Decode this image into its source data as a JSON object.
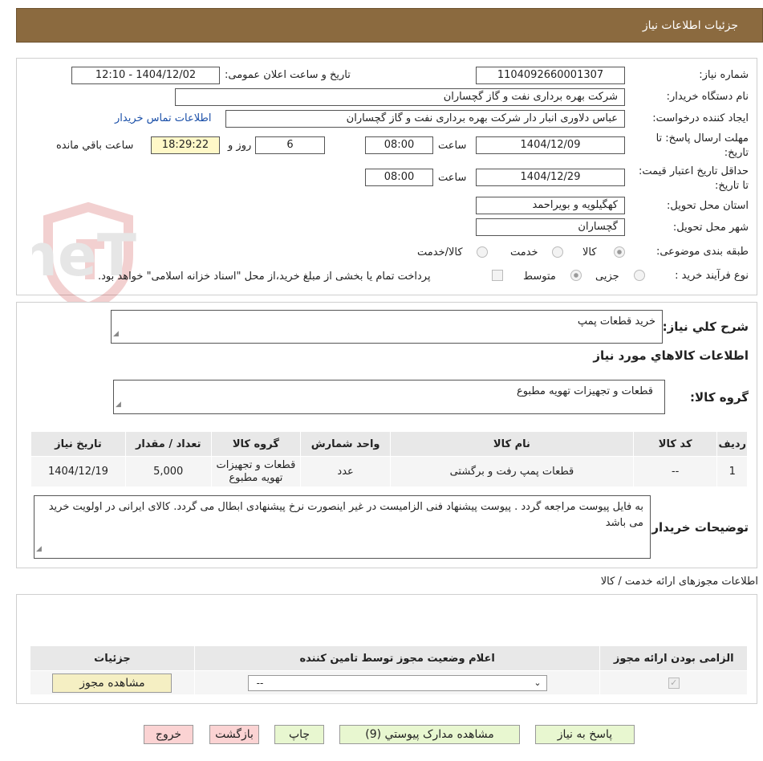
{
  "header": {
    "title": "جزئیات اطلاعات نیاز"
  },
  "watermark": {
    "text": "AriaTender.neT"
  },
  "form": {
    "need_number_label": "شماره نیاز:",
    "need_number": "1104092660001307",
    "announce_label": "تاریخ و ساعت اعلان عمومی:",
    "announce_value": "1404/12/02 - 12:10",
    "buyer_label": "نام دستگاه خریدار:",
    "buyer_value": "شرکت بهره برداری نفت و گاز گچساران",
    "creator_label": "ایجاد کننده درخواست:",
    "creator_value": "عباس دلاوری انبار دار شرکت بهره برداری نفت و گاز گچساران",
    "contact_link": "اطلاعات تماس خریدار",
    "deadline_label": "مهلت ارسال پاسخ: تا تاریخ:",
    "deadline_date": "1404/12/09",
    "time_label": "ساعت",
    "deadline_time": "08:00",
    "days_value": "6",
    "days_label": "روز و",
    "remaining_time": "18:29:22",
    "remaining_label": "ساعت باقي مانده",
    "validity_label": "حداقل تاریخ اعتبار قیمت: تا تاریخ:",
    "validity_date": "1404/12/29",
    "validity_time": "08:00",
    "province_label": "استان محل تحویل:",
    "province_value": "کهگیلویه و بویراحمد",
    "city_label": "شهر محل تحویل:",
    "city_value": "گچساران",
    "category_label": "طبقه بندی موضوعی:",
    "category_options": [
      "کالا",
      "خدمت",
      "کالا/خدمت"
    ],
    "category_selected": "کالا",
    "process_label": "نوع فرآیند خرید :",
    "process_options": [
      "جزیی",
      "متوسط"
    ],
    "process_selected": "متوسط",
    "payment_note": "پرداخت تمام یا بخشی از مبلغ خرید،از محل \"اسناد خزانه اسلامی\" خواهد بود."
  },
  "summary": {
    "label": "شرح کلي نياز:",
    "value": "خرید قطعات پمپ",
    "goods_info_title": "اطلاعات کالاهاي مورد نياز",
    "group_label": "گروه کالا:",
    "group_value": "قطعات و تجهیزات تهویه مطبوع"
  },
  "items_table": {
    "headers": [
      "رديف",
      "کد کالا",
      "نام کالا",
      "واحد شمارش",
      "گروه کالا",
      "تعداد / مقدار",
      "تاريخ نياز"
    ],
    "rows": [
      {
        "row": "1",
        "code": "--",
        "name": "قطعات پمپ رفت و برگشتی",
        "unit": "عدد",
        "group": "قطعات و تجهیزات تهویه مطبوع",
        "qty": "5,000",
        "date": "1404/12/19"
      }
    ]
  },
  "buyer_notes": {
    "label": "توضیحات خریدار:",
    "value": "به فایل پیوست مراجعه گردد . پیوست پیشنهاد فنی الزامیست در غیر اینصورت نرخ پیشنهادی ابطال می گردد. کالای ایرانی در اولویت خرید می باشد"
  },
  "licenses": {
    "section_title": "اطلاعات مجوزهای ارائه خدمت / کالا",
    "headers": [
      "الزامی بودن ارائه مجوز",
      "اعلام وضعیت مجوز توسط تامین کننده",
      "جزئیات"
    ],
    "status_select": "--",
    "view_button": "مشاهده مجوز"
  },
  "actions": {
    "reply": "پاسخ به نیاز",
    "attachments": "مشاهده مدارک پیوستي (9)",
    "print": "چاپ",
    "back": "بازگشت",
    "exit": "خروج"
  }
}
